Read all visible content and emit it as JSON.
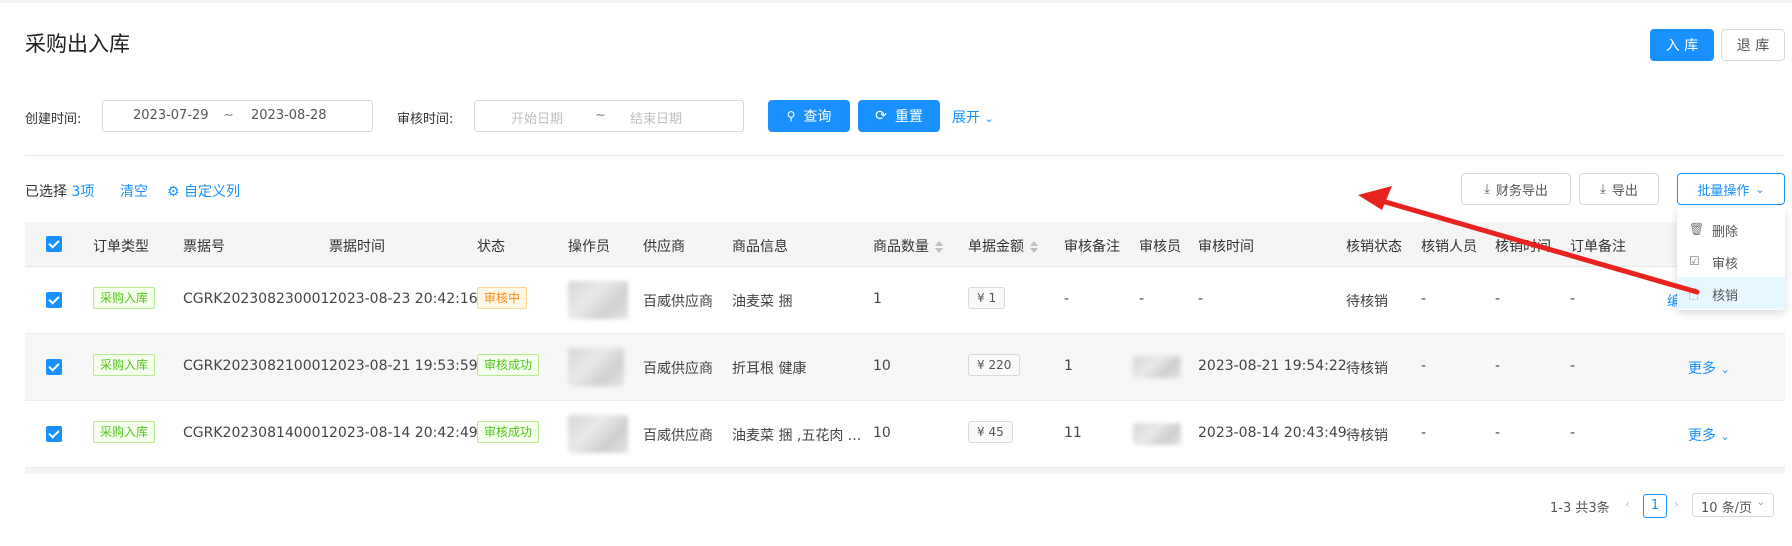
{
  "page": {
    "title": "采购出入库",
    "in_button": "入 库",
    "out_button": "退 库"
  },
  "filters": {
    "created_label": "创建时间:",
    "created_start": "2023-07-29",
    "created_end": "2023-08-28",
    "range_sep": "~",
    "audit_label": "审核时间:",
    "audit_start_placeholder": "开始日期",
    "audit_end_placeholder": "结束日期",
    "query_button": "查询",
    "reset_button": "重置",
    "expand_link": "展开"
  },
  "toolbar": {
    "selected_prefix": "已选择",
    "selected_count": "3项",
    "clear_link": "清空",
    "custom_columns_link": "自定义列",
    "finance_export_button": "财务导出",
    "export_button": "导出",
    "batch_button": "批量操作"
  },
  "batch_menu": {
    "items": [
      {
        "label": "删除",
        "icon": "trash-icon"
      },
      {
        "label": "审核",
        "icon": "check-square-icon"
      },
      {
        "label": "核销",
        "icon": "document-icon"
      }
    ]
  },
  "table": {
    "columns": [
      "订单类型",
      "票据号",
      "票据时间",
      "状态",
      "操作员",
      "供应商",
      "商品信息",
      "商品数量",
      "单据金额",
      "审核备注",
      "审核员",
      "审核时间",
      "核销状态",
      "核销人员",
      "核销时间",
      "订单备注"
    ],
    "rows": [
      {
        "type": "采购入库",
        "bill_no": "CGRK202308230001",
        "bill_time": "2023-08-23 20:42:16",
        "status": "审核中",
        "supplier": "百威供应商",
        "goods": "油麦菜 捆",
        "quantity": "1",
        "amount": "¥ 1",
        "audit_note": "-",
        "auditor": "-",
        "audit_time": "-",
        "writeoff_status": "待核销",
        "writeoff_person": "-",
        "writeoff_time": "-",
        "order_note": "-",
        "action": "编"
      },
      {
        "type": "采购入库",
        "bill_no": "CGRK202308210001",
        "bill_time": "2023-08-21 19:53:59",
        "status": "审核成功",
        "supplier": "百威供应商",
        "goods": "折耳根 健康",
        "quantity": "10",
        "amount": "¥ 220",
        "audit_note": "1",
        "audit_time": "2023-08-21 19:54:22",
        "writeoff_status": "待核销",
        "writeoff_person": "-",
        "writeoff_time": "-",
        "order_note": "-",
        "action": "更多"
      },
      {
        "type": "采购入库",
        "bill_no": "CGRK202308140001",
        "bill_time": "2023-08-14 20:42:49",
        "status": "审核成功",
        "supplier": "百威供应商",
        "goods": "油麦菜 捆 ,五花肉 ...",
        "quantity": "10",
        "amount": "¥ 45",
        "audit_note": "11",
        "audit_time": "2023-08-14 20:43:49",
        "writeoff_status": "待核销",
        "writeoff_person": "-",
        "writeoff_time": "-",
        "order_note": "-",
        "action": "更多"
      }
    ]
  },
  "pagination": {
    "summary": "1-3 共3条",
    "current_page": "1",
    "page_size": "10 条/页"
  },
  "colors": {
    "primary": "#1890ff",
    "success": "#52c41a",
    "warning": "#fa8c16",
    "annotation_arrow": "#e8231e"
  }
}
